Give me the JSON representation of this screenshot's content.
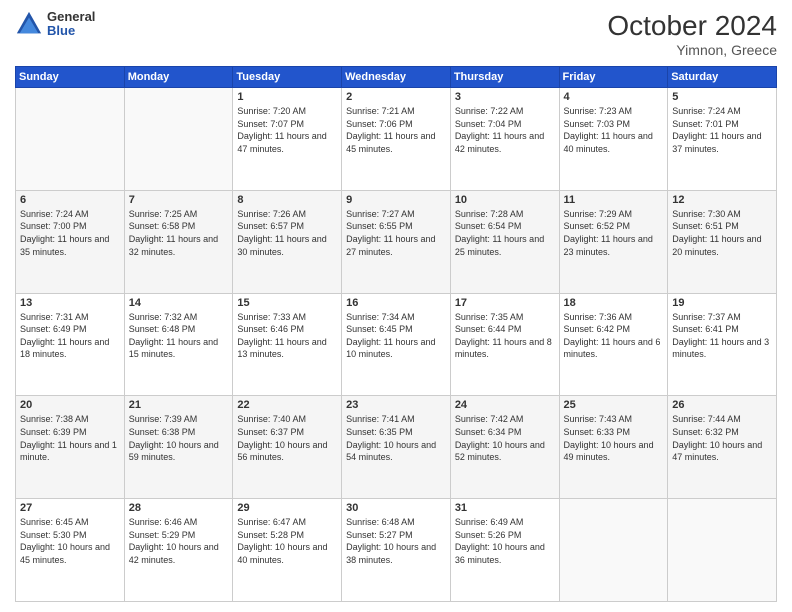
{
  "logo": {
    "general": "General",
    "blue": "Blue"
  },
  "header": {
    "month": "October 2024",
    "location": "Yimnon, Greece"
  },
  "days_of_week": [
    "Sunday",
    "Monday",
    "Tuesday",
    "Wednesday",
    "Thursday",
    "Friday",
    "Saturday"
  ],
  "weeks": [
    [
      {
        "day": "",
        "info": ""
      },
      {
        "day": "",
        "info": ""
      },
      {
        "day": "1",
        "info": "Sunrise: 7:20 AM\nSunset: 7:07 PM\nDaylight: 11 hours and 47 minutes."
      },
      {
        "day": "2",
        "info": "Sunrise: 7:21 AM\nSunset: 7:06 PM\nDaylight: 11 hours and 45 minutes."
      },
      {
        "day": "3",
        "info": "Sunrise: 7:22 AM\nSunset: 7:04 PM\nDaylight: 11 hours and 42 minutes."
      },
      {
        "day": "4",
        "info": "Sunrise: 7:23 AM\nSunset: 7:03 PM\nDaylight: 11 hours and 40 minutes."
      },
      {
        "day": "5",
        "info": "Sunrise: 7:24 AM\nSunset: 7:01 PM\nDaylight: 11 hours and 37 minutes."
      }
    ],
    [
      {
        "day": "6",
        "info": "Sunrise: 7:24 AM\nSunset: 7:00 PM\nDaylight: 11 hours and 35 minutes."
      },
      {
        "day": "7",
        "info": "Sunrise: 7:25 AM\nSunset: 6:58 PM\nDaylight: 11 hours and 32 minutes."
      },
      {
        "day": "8",
        "info": "Sunrise: 7:26 AM\nSunset: 6:57 PM\nDaylight: 11 hours and 30 minutes."
      },
      {
        "day": "9",
        "info": "Sunrise: 7:27 AM\nSunset: 6:55 PM\nDaylight: 11 hours and 27 minutes."
      },
      {
        "day": "10",
        "info": "Sunrise: 7:28 AM\nSunset: 6:54 PM\nDaylight: 11 hours and 25 minutes."
      },
      {
        "day": "11",
        "info": "Sunrise: 7:29 AM\nSunset: 6:52 PM\nDaylight: 11 hours and 23 minutes."
      },
      {
        "day": "12",
        "info": "Sunrise: 7:30 AM\nSunset: 6:51 PM\nDaylight: 11 hours and 20 minutes."
      }
    ],
    [
      {
        "day": "13",
        "info": "Sunrise: 7:31 AM\nSunset: 6:49 PM\nDaylight: 11 hours and 18 minutes."
      },
      {
        "day": "14",
        "info": "Sunrise: 7:32 AM\nSunset: 6:48 PM\nDaylight: 11 hours and 15 minutes."
      },
      {
        "day": "15",
        "info": "Sunrise: 7:33 AM\nSunset: 6:46 PM\nDaylight: 11 hours and 13 minutes."
      },
      {
        "day": "16",
        "info": "Sunrise: 7:34 AM\nSunset: 6:45 PM\nDaylight: 11 hours and 10 minutes."
      },
      {
        "day": "17",
        "info": "Sunrise: 7:35 AM\nSunset: 6:44 PM\nDaylight: 11 hours and 8 minutes."
      },
      {
        "day": "18",
        "info": "Sunrise: 7:36 AM\nSunset: 6:42 PM\nDaylight: 11 hours and 6 minutes."
      },
      {
        "day": "19",
        "info": "Sunrise: 7:37 AM\nSunset: 6:41 PM\nDaylight: 11 hours and 3 minutes."
      }
    ],
    [
      {
        "day": "20",
        "info": "Sunrise: 7:38 AM\nSunset: 6:39 PM\nDaylight: 11 hours and 1 minute."
      },
      {
        "day": "21",
        "info": "Sunrise: 7:39 AM\nSunset: 6:38 PM\nDaylight: 10 hours and 59 minutes."
      },
      {
        "day": "22",
        "info": "Sunrise: 7:40 AM\nSunset: 6:37 PM\nDaylight: 10 hours and 56 minutes."
      },
      {
        "day": "23",
        "info": "Sunrise: 7:41 AM\nSunset: 6:35 PM\nDaylight: 10 hours and 54 minutes."
      },
      {
        "day": "24",
        "info": "Sunrise: 7:42 AM\nSunset: 6:34 PM\nDaylight: 10 hours and 52 minutes."
      },
      {
        "day": "25",
        "info": "Sunrise: 7:43 AM\nSunset: 6:33 PM\nDaylight: 10 hours and 49 minutes."
      },
      {
        "day": "26",
        "info": "Sunrise: 7:44 AM\nSunset: 6:32 PM\nDaylight: 10 hours and 47 minutes."
      }
    ],
    [
      {
        "day": "27",
        "info": "Sunrise: 6:45 AM\nSunset: 5:30 PM\nDaylight: 10 hours and 45 minutes."
      },
      {
        "day": "28",
        "info": "Sunrise: 6:46 AM\nSunset: 5:29 PM\nDaylight: 10 hours and 42 minutes."
      },
      {
        "day": "29",
        "info": "Sunrise: 6:47 AM\nSunset: 5:28 PM\nDaylight: 10 hours and 40 minutes."
      },
      {
        "day": "30",
        "info": "Sunrise: 6:48 AM\nSunset: 5:27 PM\nDaylight: 10 hours and 38 minutes."
      },
      {
        "day": "31",
        "info": "Sunrise: 6:49 AM\nSunset: 5:26 PM\nDaylight: 10 hours and 36 minutes."
      },
      {
        "day": "",
        "info": ""
      },
      {
        "day": "",
        "info": ""
      }
    ]
  ]
}
